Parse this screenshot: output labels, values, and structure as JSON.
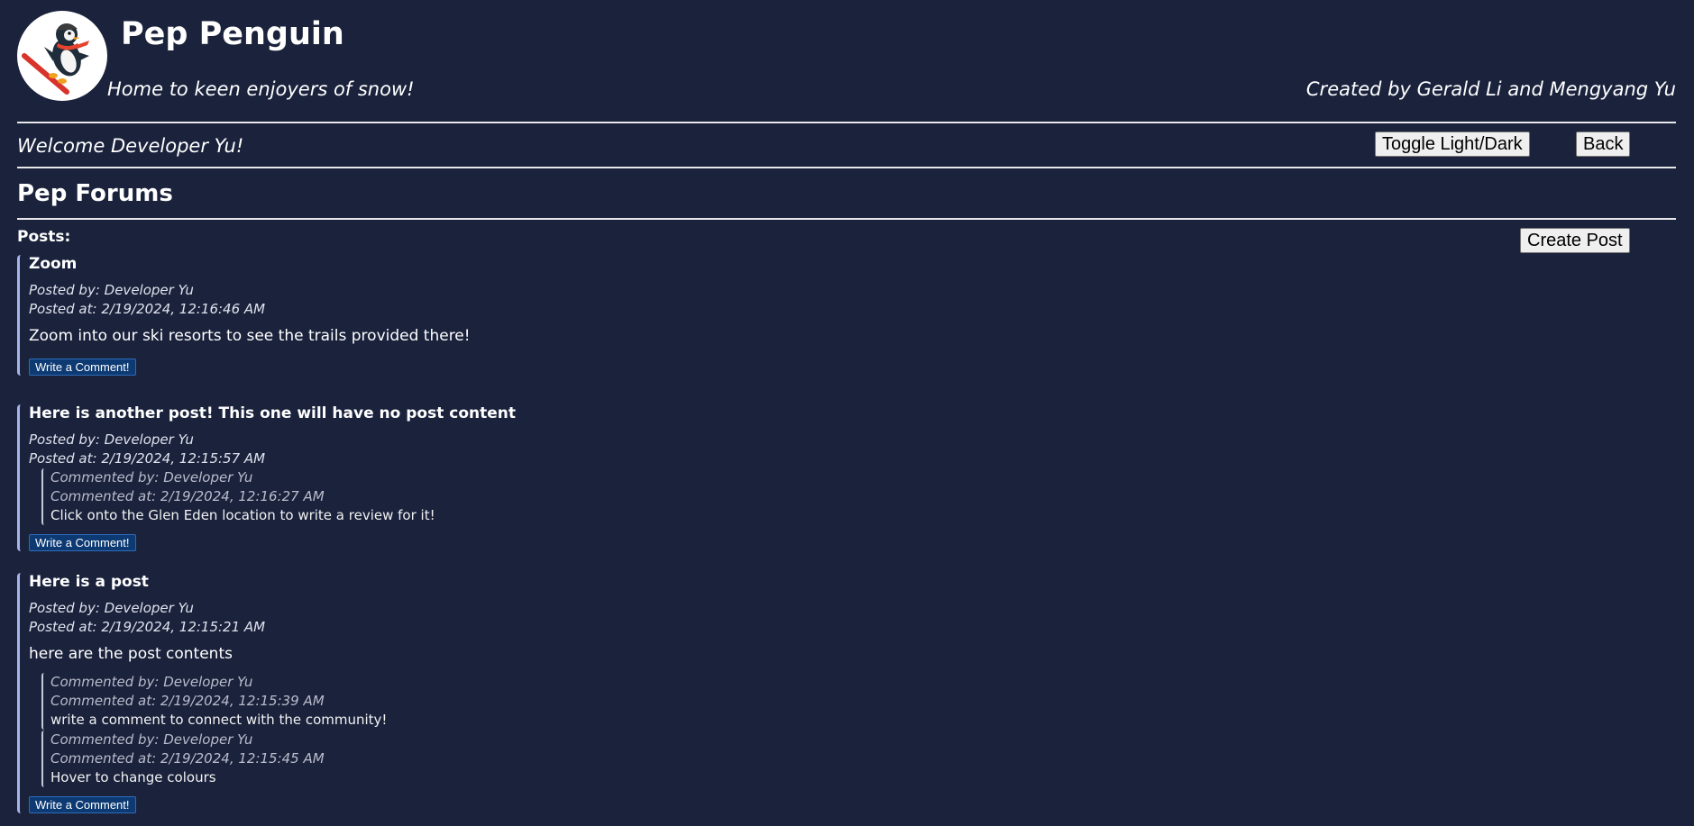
{
  "header": {
    "title": "Pep Penguin",
    "tagline": "Home to keen enjoyers of snow!",
    "credits": "Created by Gerald Li and Mengyang Yu"
  },
  "nav": {
    "welcome": "Welcome Developer Yu!",
    "toggle_label": "Toggle Light/Dark",
    "back_label": "Back"
  },
  "forum": {
    "title": "Pep Forums",
    "posts_label": "Posts:",
    "create_label": "Create Post",
    "write_comment_label": "Write a Comment!"
  },
  "posts": [
    {
      "title": "Zoom",
      "posted_by": "Posted by: Developer Yu",
      "posted_at": "Posted at: 2/19/2024, 12:16:46 AM",
      "content": "Zoom into our ski resorts to see the trails provided there!",
      "comments": []
    },
    {
      "title": "Here is another post! This one will have no post content",
      "posted_by": "Posted by: Developer Yu",
      "posted_at": "Posted at: 2/19/2024, 12:15:57 AM",
      "content": "",
      "comments": [
        {
          "by": "Commented by: Developer Yu",
          "at": "Commented at: 2/19/2024, 12:16:27 AM",
          "text": "Click onto the Glen Eden location to write a review for it!"
        }
      ]
    },
    {
      "title": "Here is a post",
      "posted_by": "Posted by: Developer Yu",
      "posted_at": "Posted at: 2/19/2024, 12:15:21 AM",
      "content": "here are the post contents",
      "comments": [
        {
          "by": "Commented by: Developer Yu",
          "at": "Commented at: 2/19/2024, 12:15:39 AM",
          "text": "write a comment to connect with the community!"
        },
        {
          "by": "Commented by: Developer Yu",
          "at": "Commented at: 2/19/2024, 12:15:45 AM",
          "text": "Hover to change colours"
        }
      ]
    }
  ]
}
